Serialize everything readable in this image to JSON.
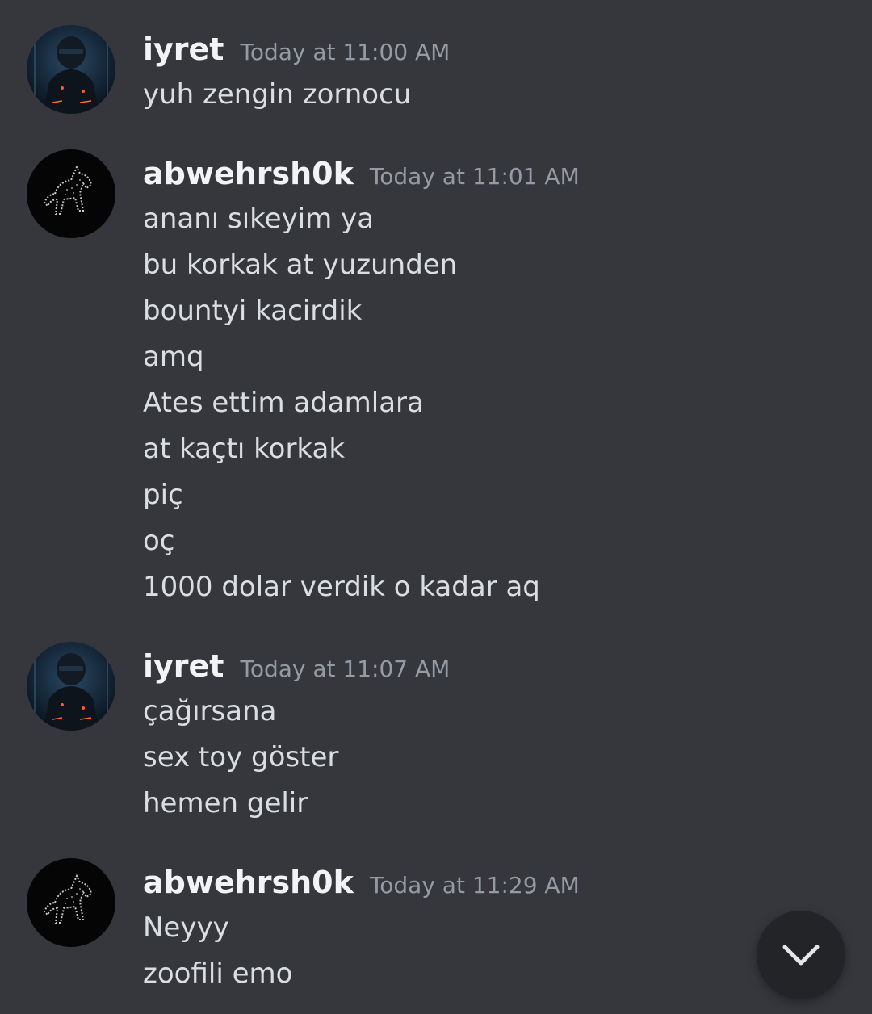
{
  "messages": [
    {
      "username": "iyret",
      "timestamp": "Today at 11:00 AM",
      "avatar": "robot-helmet-avatar",
      "lines": [
        "yuh zengin zornocu"
      ]
    },
    {
      "username": "abwehrsh0k",
      "timestamp": "Today at 11:01 AM",
      "avatar": "horse-avatar",
      "lines": [
        "ananı sıkeyim ya",
        "bu korkak at yuzunden",
        "bountyi kacirdik",
        "amq",
        "Ates ettim adamlara",
        "at kaçtı korkak",
        "piç",
        "oç",
        "1000 dolar verdik o kadar aq"
      ]
    },
    {
      "username": "iyret",
      "timestamp": "Today at 11:07 AM",
      "avatar": "robot-helmet-avatar",
      "lines": [
        "çağırsana",
        "sex toy göster",
        "hemen gelir"
      ]
    },
    {
      "username": "abwehrsh0k",
      "timestamp": "Today at 11:29 AM",
      "avatar": "horse-avatar",
      "lines": [
        "Neyyy",
        "zoofili emo"
      ]
    }
  ],
  "jump_button": {
    "icon": "chevron-down-icon"
  },
  "colors": {
    "background": "#36373d",
    "username": "#f2f3f5",
    "timestamp": "#949ba4",
    "text": "#dbdee1",
    "jump_button_bg": "#232428"
  }
}
